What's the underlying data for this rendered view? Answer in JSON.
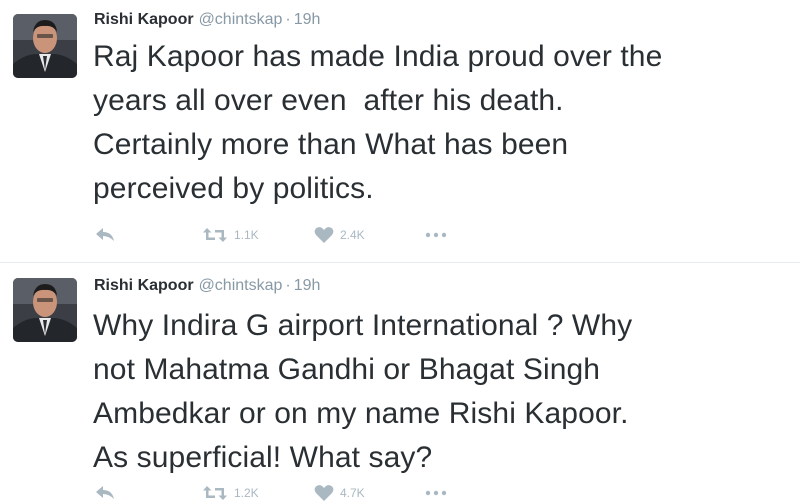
{
  "colors": {
    "text": "#292f33",
    "muted": "#8899a6",
    "action_icons": "#aab8c2",
    "divider": "#e6ecf0"
  },
  "tweets": [
    {
      "author_name": "Rishi Kapoor",
      "author_handle": "@chintskap",
      "separator": "·",
      "time": "19h",
      "text_lines": [
        "Raj Kapoor has made India proud over the",
        "years all over even  after his death.",
        "Certainly more than What has been",
        "perceived by politics."
      ],
      "retweet_count": "1.1K",
      "like_count": "2.4K",
      "icons": [
        "reply-icon",
        "retweet-icon",
        "like-icon",
        "more-icon"
      ]
    },
    {
      "author_name": "Rishi Kapoor",
      "author_handle": "@chintskap",
      "separator": "·",
      "time": "19h",
      "text_lines": [
        "Why Indira G airport International ? Why",
        "not Mahatma Gandhi or Bhagat Singh",
        "Ambedkar or on my name Rishi Kapoor.",
        "As superficial! What say?"
      ],
      "retweet_count": "1.2K",
      "like_count": "4.7K",
      "icons": [
        "reply-icon",
        "retweet-icon",
        "like-icon",
        "more-icon"
      ]
    }
  ]
}
